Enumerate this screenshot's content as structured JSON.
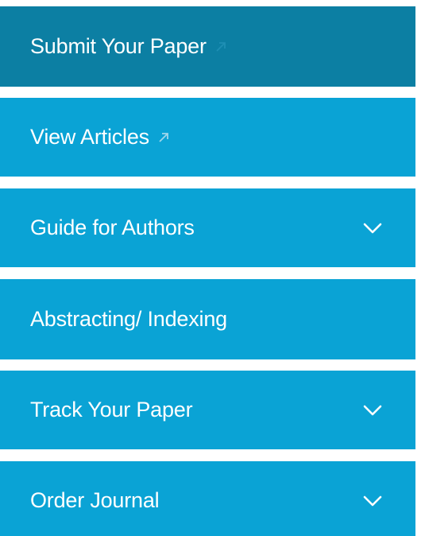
{
  "menu": {
    "items": [
      {
        "label": "Submit Your Paper",
        "icon": "external-link-icon",
        "active": true
      },
      {
        "label": "View Articles",
        "icon": "external-link-icon"
      },
      {
        "label": "Guide for Authors",
        "icon": "chevron-down-icon"
      },
      {
        "label": "Abstracting/ Indexing",
        "icon": ""
      },
      {
        "label": "Track Your Paper",
        "icon": "chevron-down-icon"
      },
      {
        "label": "Order Journal",
        "icon": "chevron-down-icon"
      }
    ]
  },
  "colors": {
    "active_bg": "#0c7fa3",
    "item_bg": "#0aa3d5",
    "text": "#ffffff",
    "external_icon_active": "#1f8fb4",
    "external_icon": "#9fd6ea"
  }
}
